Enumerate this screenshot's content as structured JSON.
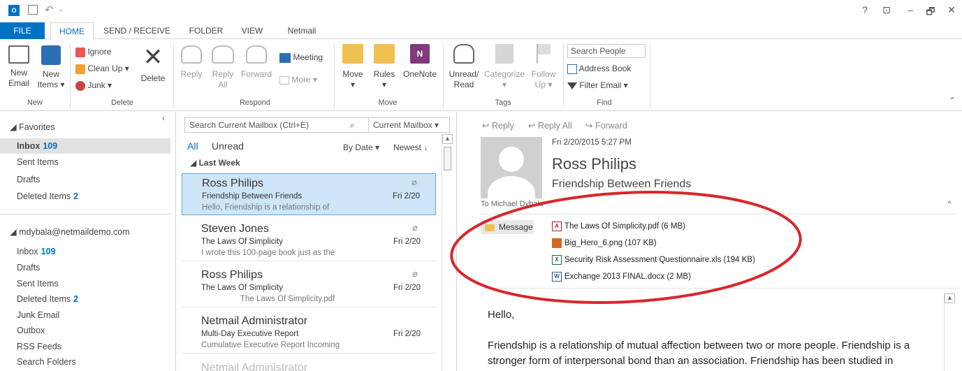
{
  "ribbon_tabs": [
    "FILE",
    "HOME",
    "SEND / RECEIVE",
    "FOLDER",
    "VIEW",
    "Netmail"
  ],
  "window_controls": [
    "?",
    "⊡",
    "–",
    "🗗",
    "✕"
  ],
  "ribbon": {
    "new_email": [
      "New",
      "Email"
    ],
    "new_items": [
      "New",
      "Items ▾"
    ],
    "ignore": "Ignore",
    "clean_up": "Clean Up ▾",
    "junk": "Junk ▾",
    "delete": "Delete",
    "reply": "Reply",
    "reply_all": [
      "Reply",
      "All"
    ],
    "forward": "Forward",
    "meeting": "Meeting",
    "more": "More ▾",
    "move": "Move",
    "rules": "Rules",
    "onenote": "OneNote",
    "unread_read": [
      "Unread/",
      "Read"
    ],
    "categorize": "Categorize",
    "follow_up": [
      "Follow",
      "Up ▾"
    ],
    "search_people": "Search People",
    "address_book": "Address Book",
    "filter_email": "Filter Email ▾",
    "groups": [
      "New",
      "Delete",
      "Respond",
      "Move",
      "Tags",
      "Find"
    ]
  },
  "folders": {
    "favorites_header": "◢ Favorites",
    "favorites": [
      {
        "label": "Inbox",
        "count": "109"
      },
      {
        "label": "Sent Items",
        "count": ""
      },
      {
        "label": "Drafts",
        "count": ""
      },
      {
        "label": "Deleted Items",
        "count": "2"
      }
    ],
    "account_header": "◢ mdybala@netmaildemo.com",
    "account": [
      {
        "label": "Inbox",
        "count": "109"
      },
      {
        "label": "Drafts",
        "count": ""
      },
      {
        "label": "Sent Items",
        "count": ""
      },
      {
        "label": "Deleted Items",
        "count": "2"
      },
      {
        "label": "Junk Email",
        "count": ""
      },
      {
        "label": "Outbox",
        "count": ""
      },
      {
        "label": "RSS Feeds",
        "count": ""
      },
      {
        "label": "Search Folders",
        "count": ""
      }
    ]
  },
  "message_list": {
    "search_placeholder": "Search Current Mailbox (Ctrl+E)",
    "scope": "Current Mailbox",
    "filter_all": "All",
    "filter_unread": "Unread",
    "sort_by": "By Date ▾",
    "sort_order": "Newest ↓",
    "group_header": "◢ Last Week",
    "messages": [
      {
        "from": "Ross Philips",
        "subject": "Friendship Between Friends",
        "preview": "Hello,  Friendship is a relationship of",
        "date": "Fri 2/20"
      },
      {
        "from": "Steven Jones",
        "subject": "The Laws Of Simplicity",
        "preview": "I wrote this 100-page book just as the",
        "date": "Fri 2/20"
      },
      {
        "from": "Ross Philips",
        "subject": "The Laws Of Simplicity",
        "preview": "The Laws Of Simplicity.pdf",
        "date": "Fri 2/20"
      },
      {
        "from": "Netmail Administrator",
        "subject": "Multi-Day Executive Report",
        "preview": "Cumulative Executive Report  Incoming",
        "date": "Fri 2/20"
      }
    ],
    "partial_next": "Netmail Administrator"
  },
  "reading_pane": {
    "reply": "Reply",
    "reply_all": "Reply All",
    "forward": "Forward",
    "datetime": "Fri 2/20/2015 5:27 PM",
    "sender": "Ross Philips",
    "subject": "Friendship Between Friends",
    "to_label": "To",
    "to": "Michael Dybala",
    "message_tab": "Message",
    "attachments": [
      {
        "name": "The Laws Of Simplicity.pdf (6 MB)",
        "type": "pdf",
        "color": "#c4161c"
      },
      {
        "name": "Big_Hero_6.png (107 KB)",
        "type": "png",
        "color": "#d2691e"
      },
      {
        "name": "Security Risk Assessment Questionnaire.xls (194 KB)",
        "type": "xls",
        "color": "#1e7145"
      },
      {
        "name": "Exchange 2013 FINAL.docx (2 MB)",
        "type": "docx",
        "color": "#2b579a"
      }
    ],
    "body": [
      "Hello,",
      "Friendship is a relationship of mutual affection between two or more people. Friendship is a",
      "stronger form of interpersonal bond than an association. Friendship has been studied in"
    ]
  },
  "colors": {
    "accent": "#0072c6",
    "selection": "#cde6f7",
    "annotation": "#d8262c"
  }
}
